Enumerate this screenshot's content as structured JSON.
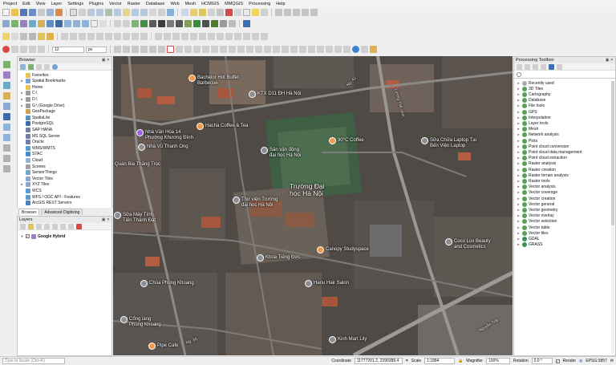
{
  "menu": [
    "Project",
    "Edit",
    "View",
    "Layer",
    "Settings",
    "Plugins",
    "Vector",
    "Raster",
    "Database",
    "Web",
    "Mesh",
    "HCMGIS",
    "MMQGIS",
    "Processing",
    "Help"
  ],
  "toolbar": {
    "scale_input": "12",
    "unit_select": "px"
  },
  "browser": {
    "title": "Browser",
    "items": [
      {
        "label": "Favorites",
        "icon": "star-icon",
        "arrow": ""
      },
      {
        "label": "Spatial Bookmarks",
        "icon": "bookmark-icon",
        "arrow": "▸"
      },
      {
        "label": "Home",
        "icon": "folder-icon",
        "arrow": ""
      },
      {
        "label": "C:\\",
        "icon": "drive-icon",
        "arrow": "▸"
      },
      {
        "label": "D:\\",
        "icon": "drive-icon",
        "arrow": "▸"
      },
      {
        "label": "G:\\ (Google Drive)",
        "icon": "drive-icon",
        "arrow": "▸"
      },
      {
        "label": "GeoPackage",
        "icon": "geopackage-icon",
        "arrow": ""
      },
      {
        "label": "SpatiaLite",
        "icon": "spatialite-icon",
        "arrow": ""
      },
      {
        "label": "PostgreSQL",
        "icon": "postgresql-icon",
        "arrow": ""
      },
      {
        "label": "SAP HANA",
        "icon": "database-icon",
        "arrow": ""
      },
      {
        "label": "MS SQL Server",
        "icon": "database-icon",
        "arrow": ""
      },
      {
        "label": "Oracle",
        "icon": "database-icon",
        "arrow": ""
      },
      {
        "label": "WMS/WMTS",
        "icon": "globe-icon",
        "arrow": ""
      },
      {
        "label": "STAC",
        "icon": "stac-icon",
        "arrow": ""
      },
      {
        "label": "Cloud",
        "icon": "cloud-icon",
        "arrow": ""
      },
      {
        "label": "Scenes",
        "icon": "scene-icon",
        "arrow": ""
      },
      {
        "label": "SensorThings",
        "icon": "sensor-icon",
        "arrow": ""
      },
      {
        "label": "Vector Tiles",
        "icon": "tiles-icon",
        "arrow": ""
      },
      {
        "label": "XYZ Tiles",
        "icon": "tiles-icon",
        "arrow": "▸"
      },
      {
        "label": "WCS",
        "icon": "globe-icon",
        "arrow": ""
      },
      {
        "label": "WFS / OGC API - Features",
        "icon": "globe-icon",
        "arrow": ""
      },
      {
        "label": "ArcGIS REST Servers",
        "icon": "arcgis-icon",
        "arrow": ""
      }
    ],
    "tabs": [
      "Browser",
      "Advanced Digitizing"
    ]
  },
  "layers": {
    "title": "Layers",
    "items": [
      {
        "label": "Google Hybrid",
        "checked": true
      }
    ]
  },
  "processing": {
    "title": "Processing Toolbox",
    "items": [
      "Recently used",
      "3D Tiles",
      "Cartography",
      "Database",
      "File tools",
      "GPS",
      "Interpolation",
      "Layer tools",
      "Mesh",
      "Network analysis",
      "Plots",
      "Point cloud conversion",
      "Point cloud data management",
      "Point cloud extraction",
      "Raster analysis",
      "Raster creation",
      "Raster terrain analysis",
      "Raster tools",
      "Vector analysis",
      "Vector coverage",
      "Vector creation",
      "Vector general",
      "Vector geometry",
      "Vector overlay",
      "Vector selection",
      "Vector table",
      "Vector tiles",
      "GDAL",
      "GRASS"
    ]
  },
  "map_labels": [
    {
      "text": "Bachelor Hot Buffet",
      "sub": "Barbecue"
    },
    {
      "text": "KTX D11 ĐH Hà Nội"
    },
    {
      "text": "Nhà Văn Hóa 14",
      "sub": "Phường Khương Đình"
    },
    {
      "text": "Nhà Vũ Thanh Ong"
    },
    {
      "text": "Hacha Coffee & Tea"
    },
    {
      "text": "Sân vận động",
      "sub": "đại học Hà Nội"
    },
    {
      "text": "90°C Coffee"
    },
    {
      "text": "Sửa Chữa Laptop Tại",
      "sub": "Bến Viện Laptop"
    },
    {
      "text": "Quán Bia Thăng Trọc"
    },
    {
      "text": "Trường Đại",
      "sub": "học Hà Nội"
    },
    {
      "text": "Thư viện Trường",
      "sub": "đại học Hà Nội"
    },
    {
      "text": "Sửa Máy Tính",
      "sub": "Tiến Thành Đạt"
    },
    {
      "text": "Khoa Tiếng Đức"
    },
    {
      "text": "Canopy Studyspace"
    },
    {
      "text": "Chùa Phùng Khoang"
    },
    {
      "text": "Hanu Hair Salon"
    },
    {
      "text": "Coco Lux Beauty",
      "sub": "and Cosmetics"
    },
    {
      "text": "Cổng làng",
      "sub": "Phùng Khoang"
    },
    {
      "text": "Pipe Cafe"
    },
    {
      "text": "Kinh Mart Lily"
    }
  ],
  "roads": [
    "Phùng Khoang",
    "Lương Thế Vinh",
    "Nguyễn Trãi",
    "Ng. 30",
    "Ng. 42"
  ],
  "status": {
    "locate_placeholder": "Type to locate (Ctrl+K)",
    "coordinate_label": "Coordinate",
    "coordinate_value": "11777201.2, 2390388.4",
    "scale_label": "Scale",
    "scale_value": "1:1884",
    "magnifier_label": "Magnifier",
    "magnifier_value": "100%",
    "rotation_label": "Rotation",
    "rotation_value": "0.0 °",
    "render_label": "Render",
    "crs_label": "EPSG:3857"
  },
  "colors": {
    "accent": "#2d6fc4",
    "pin_orange": "#f2994a",
    "pin_purple": "#9b5fe0",
    "pin_gray": "#8a8f96",
    "map_bg": "#57524d"
  }
}
